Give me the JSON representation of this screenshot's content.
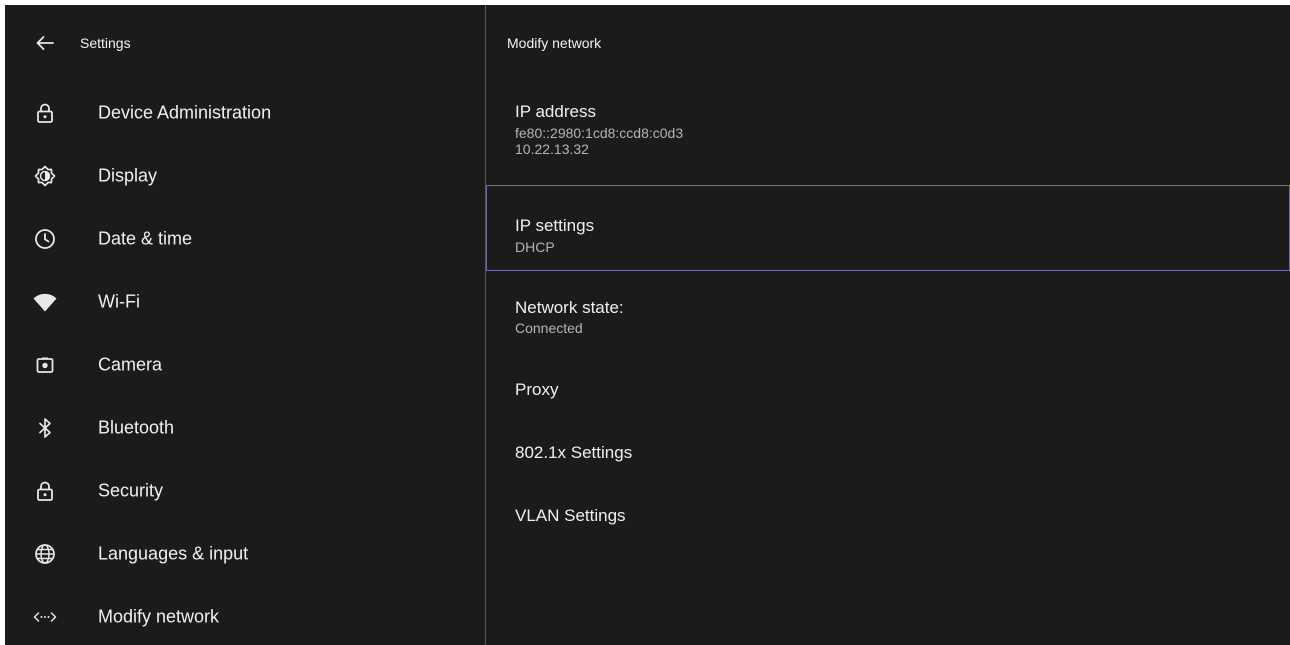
{
  "header": {
    "title": "Settings",
    "back_icon": "arrow-left-icon"
  },
  "sidebar": {
    "items": [
      {
        "label": "Device Administration",
        "icon": "lock-icon"
      },
      {
        "label": "Display",
        "icon": "brightness-icon"
      },
      {
        "label": "Date & time",
        "icon": "clock-icon"
      },
      {
        "label": "Wi-Fi",
        "icon": "wifi-icon"
      },
      {
        "label": "Camera",
        "icon": "camera-icon"
      },
      {
        "label": "Bluetooth",
        "icon": "bluetooth-icon"
      },
      {
        "label": "Security",
        "icon": "lock-icon"
      },
      {
        "label": "Languages & input",
        "icon": "globe-icon"
      },
      {
        "label": "Modify network",
        "icon": "network-icon"
      }
    ]
  },
  "detail": {
    "title": "Modify network",
    "ip_address": {
      "label": "IP address",
      "values": [
        "fe80::2980:1cd8:ccd8:c0d3",
        "10.22.13.32"
      ]
    },
    "ip_settings": {
      "label": "IP settings",
      "value": "DHCP"
    },
    "network_state": {
      "label": "Network state:",
      "value": "Connected"
    },
    "proxy": {
      "label": "Proxy"
    },
    "dot1x": {
      "label": "802.1x Settings"
    },
    "vlan": {
      "label": "VLAN Settings"
    }
  },
  "colors": {
    "background": "#1c1b1a",
    "divider": "#58585a",
    "text_primary": "#f0f0f0",
    "text_secondary": "#b5b5b5",
    "selection_outline": "#6e6a9e"
  }
}
